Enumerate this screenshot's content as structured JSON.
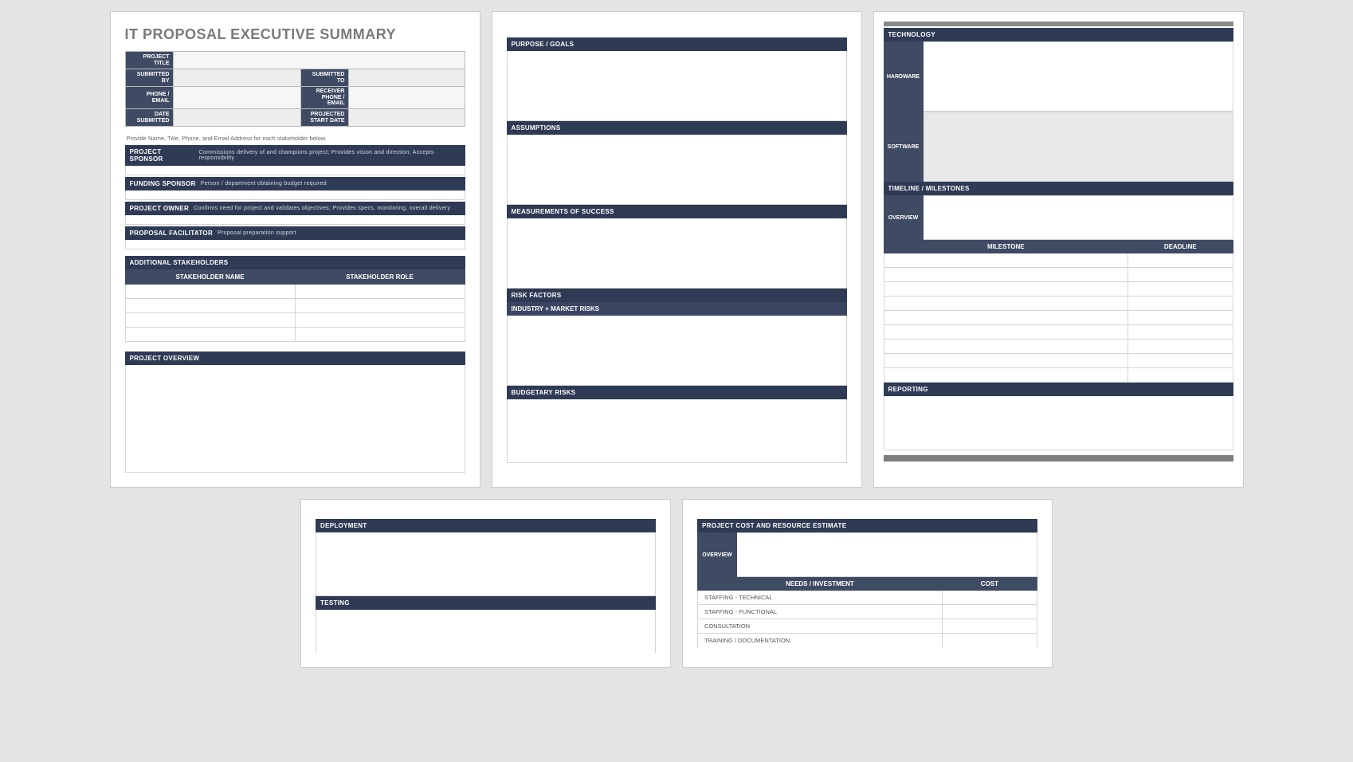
{
  "page1": {
    "title": "IT PROPOSAL EXECUTIVE SUMMARY",
    "info": {
      "project_title": "PROJECT TITLE",
      "submitted_by": "SUBMITTED BY",
      "submitted_to": "SUBMITTED TO",
      "phone_email": "PHONE / EMAIL",
      "receiver_phone_email": "RECEIVER PHONE / EMAIL",
      "date_submitted": "DATE SUBMITTED",
      "projected_start_date": "PROJECTED START  DATE"
    },
    "hint": "Provide Name, Title, Phone, and Email Address for each stakeholder below.",
    "roles": {
      "sponsor_name": "PROJECT SPONSOR",
      "sponsor_desc": "Commissions delivery of and champions project; Provides vision and direction; Accepts responsibility",
      "funding_name": "FUNDING SPONSOR",
      "funding_desc": "Person / department obtaining budget required",
      "owner_name": "PROJECT OWNER",
      "owner_desc": "Confirms need for project and validates objectives; Provides specs, monitoring, overall delivery",
      "facilitator_name": "PROPOSAL FACILITATOR",
      "facilitator_desc": "Proposal preparation support"
    },
    "add_stake_hdr": "ADDITIONAL STAKEHOLDERS",
    "stake_name_hdr": "STAKEHOLDER NAME",
    "stake_role_hdr": "STAKEHOLDER ROLE",
    "overview_hdr": "PROJECT OVERVIEW"
  },
  "page2": {
    "purpose": "PURPOSE / GOALS",
    "assumptions": "ASSUMPTIONS",
    "measurements": "MEASUREMENTS OF SUCCESS",
    "risk_factors": "RISK FACTORS",
    "industry_risks": "INDUSTRY + MARKET RISKS",
    "budgetary_risks": "BUDGETARY RISKS"
  },
  "page3": {
    "technology": "TECHNOLOGY",
    "hardware": "HARDWARE",
    "software": "SOFTWARE",
    "timeline": "TIMELINE / MILESTONES",
    "overview": "OVERVIEW",
    "milestone_hdr": "MILESTONE",
    "deadline_hdr": "DEADLINE",
    "reporting": "REPORTING"
  },
  "page4": {
    "deployment": "DEPLOYMENT",
    "testing": "TESTING"
  },
  "page5": {
    "hdr": "PROJECT COST AND RESOURCE ESTIMATE",
    "overview": "OVERVIEW",
    "needs_hdr": "NEEDS / INVESTMENT",
    "cost_hdr": "COST",
    "rows": [
      "STAFFING - TECHNICAL",
      "STAFFING - FUNCTIONAL",
      "CONSULTATION",
      "TRAINING / DOCUMENTATION"
    ]
  }
}
